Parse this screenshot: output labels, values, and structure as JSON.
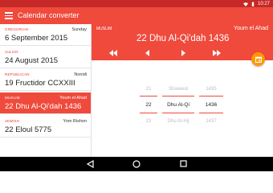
{
  "status_bar": {
    "time": "10:27"
  },
  "toolbar": {
    "title": "Calendar converter"
  },
  "calendars": [
    {
      "name": "GREGORIAN",
      "day": "Sunday",
      "date": "6 September 2015",
      "selected": false
    },
    {
      "name": "JULIAN",
      "day": "",
      "date": "24 August 2015",
      "selected": false
    },
    {
      "name": "REPUBLICAN",
      "day": "Nonidi",
      "date": "19 Fructidor CCXXIII",
      "selected": false
    },
    {
      "name": "MUSLIM",
      "day": "Youm el Ahad",
      "date": "22 Dhu Al-Qi'dah 1436",
      "selected": true
    },
    {
      "name": "JEWISH",
      "day": "Yom Rishon",
      "date": "22 Eloul 5775",
      "selected": false
    }
  ],
  "detail": {
    "calendar_name": "MUSLIM",
    "day_name": "Youm el Ahad",
    "date": "22 Dhu Al-Qi'dah 1436"
  },
  "picker": {
    "prev": {
      "day": "21",
      "month": "Shawwal",
      "year": "1435"
    },
    "current": {
      "day": "22",
      "month": "Dhu Al-Qi",
      "year": "1436"
    },
    "next": {
      "day": "23",
      "month": "Dhu Al-Hij",
      "year": "1437"
    }
  },
  "colors": {
    "accent": "#ef4a3c",
    "status_bar": "#c62828",
    "fab": "#ff9800"
  },
  "icons": [
    "menu-icon",
    "fast-rewind-icon",
    "previous-icon",
    "next-icon",
    "fast-forward-icon",
    "calendar-today-icon",
    "back-icon",
    "home-icon",
    "recents-icon"
  ]
}
